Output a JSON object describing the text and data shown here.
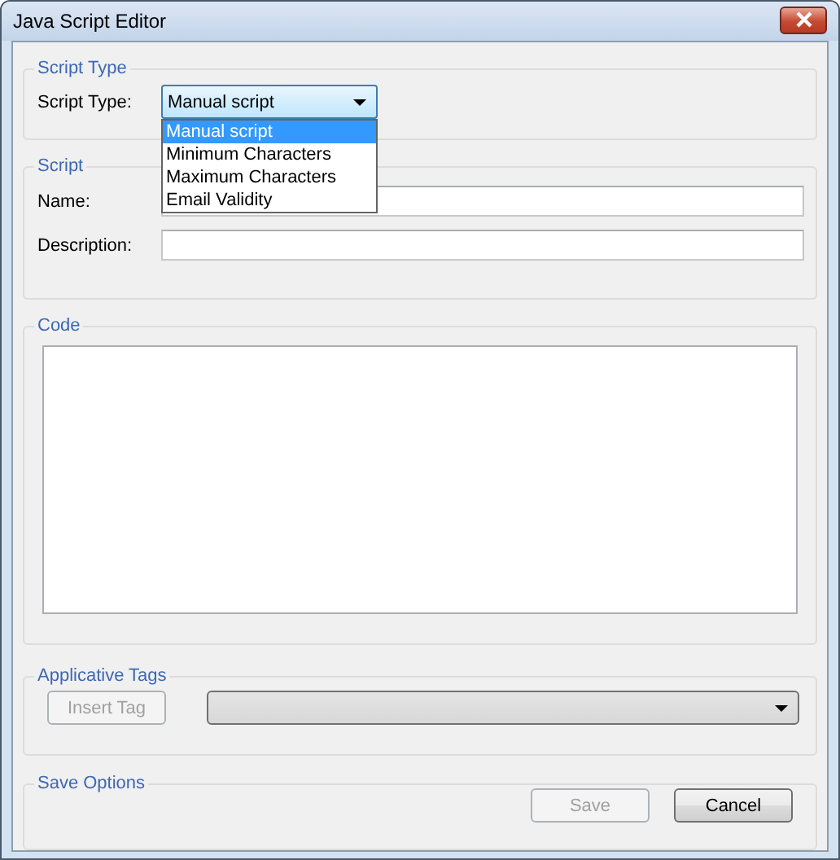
{
  "window": {
    "title": "Java Script Editor"
  },
  "script_type_group": {
    "legend": "Script Type",
    "label": "Script Type:",
    "combo": {
      "value": "Manual script",
      "expanded": true,
      "options": [
        {
          "label": "Manual script",
          "selected": true
        },
        {
          "label": "Minimum Characters",
          "selected": false
        },
        {
          "label": "Maximum Characters",
          "selected": false
        },
        {
          "label": "Email Validity",
          "selected": false
        }
      ]
    }
  },
  "script_group": {
    "legend": "Script",
    "fields": [
      {
        "label": "Name:"
      },
      {
        "label": "Description:"
      }
    ]
  },
  "code_group": {
    "legend": "Code"
  },
  "tags_group": {
    "legend": "Applicative Tags",
    "insert_button": {
      "label": "Insert Tag",
      "disabled": true
    },
    "tag_combo": {
      "disabled": true
    }
  },
  "save_group": {
    "legend": "Save Options",
    "buttons": [
      {
        "label": "Save",
        "disabled": true
      },
      {
        "label": "Cancel",
        "disabled": false
      }
    ]
  }
}
